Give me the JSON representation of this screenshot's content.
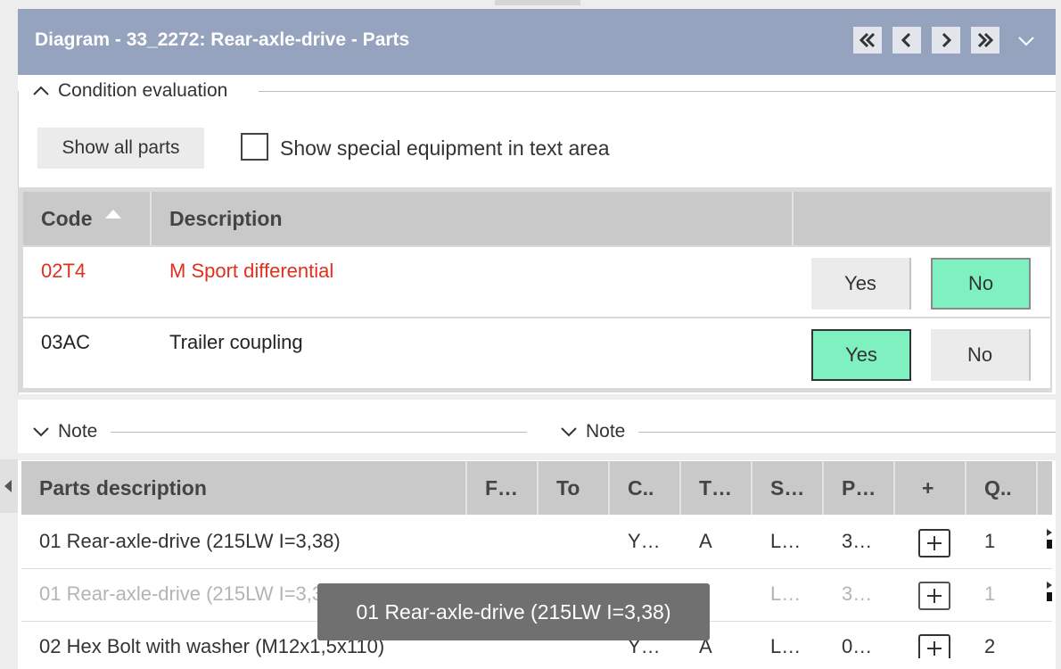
{
  "panel": {
    "title": "Diagram - 33_2272: Rear-axle-drive - Parts",
    "nav_icons": [
      "double-chevron-left-icon",
      "chevron-left-icon",
      "chevron-right-icon",
      "double-chevron-right-icon",
      "chevron-down-icon"
    ]
  },
  "condition_evaluation": {
    "legend": "Condition evaluation",
    "show_all_button": "Show all parts",
    "special_equipment_checkbox": {
      "label": "Show special equipment in text area",
      "checked": false
    },
    "columns": {
      "code": "Code",
      "description": "Description"
    },
    "sort": "code-ascending",
    "rows": [
      {
        "code": "02T4",
        "description": "M Sport differential",
        "yes": "Yes",
        "no": "No",
        "selected": "No",
        "highlight_color": "#e0301e"
      },
      {
        "code": "03AC",
        "description": "Trailer coupling",
        "yes": "Yes",
        "no": "No",
        "selected": "Yes"
      }
    ]
  },
  "notes": [
    {
      "legend": "Note"
    },
    {
      "legend": "Note"
    }
  ],
  "parts": {
    "columns": [
      "Parts description",
      "F…",
      "To",
      "C..",
      "T…",
      "S…",
      "P…",
      "+",
      "Q.."
    ],
    "rows": [
      {
        "description": "01 Rear-axle-drive (215LW I=3,38)",
        "from": "",
        "to": "",
        "c": "Y…",
        "t": "A",
        "s": "L…",
        "p": "3…",
        "q": "1",
        "faded": false
      },
      {
        "description": "01 Rear-axle-drive (215LW I=3,38)",
        "from": "",
        "to": "",
        "c": "",
        "t": "",
        "s": "L…",
        "p": "3…",
        "q": "1",
        "faded": true
      },
      {
        "description": "02 Hex Bolt with washer (M12x1,5x110)",
        "from": "",
        "to": "",
        "c": "Y…",
        "t": "A",
        "s": "L…",
        "p": "0…",
        "q": "2",
        "faded": false
      }
    ]
  },
  "tooltip": {
    "text": "01 Rear-axle-drive (215LW I=3,38)"
  },
  "colors": {
    "header": "#95a3bf",
    "selected": "#7ff0c0",
    "red_text": "#e0301e",
    "tooltip": "#707070"
  }
}
